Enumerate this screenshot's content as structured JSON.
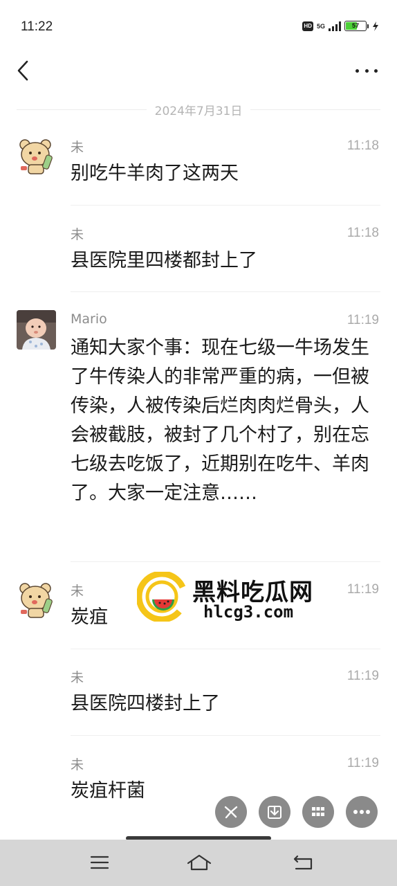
{
  "status_bar": {
    "time": "11:22",
    "hd_label": "HD",
    "network_label": "5G",
    "battery_level": "57",
    "battery_fraction": 0.57
  },
  "nav": {
    "back_icon": "chevron-left-icon",
    "more_icon": "ellipsis-icon"
  },
  "chat": {
    "date_divider": "2024年7月31日",
    "messages": [
      {
        "name": "未",
        "time": "11:18",
        "text": "别吃牛羊肉了这两天",
        "avatar": "bear-cartoon"
      },
      {
        "name": "未",
        "time": "11:18",
        "text": "县医院里四楼都封上了",
        "avatar": ""
      },
      {
        "name": "Mario",
        "time": "11:19",
        "text": "通知大家个事：现在七级一牛场发生了牛传染人的非常严重的病，一但被传染，人被传染后烂肉肉烂骨头，人会被截肢，被封了几个村了，别在忘七级去吃饭了，近期别在吃牛、羊肉了。大家一定注意……",
        "avatar": "baby-photo"
      },
      {
        "name": "未",
        "time": "11:19",
        "text": "炭疽",
        "avatar": "bear-cartoon"
      },
      {
        "name": "未",
        "time": "11:19",
        "text": "县医院四楼封上了",
        "avatar": ""
      },
      {
        "name": "未",
        "time": "11:19",
        "text": "炭疽杆菌",
        "avatar": ""
      }
    ]
  },
  "watermark": {
    "title": "黑料吃瓜网",
    "url": "hlcg3.com"
  },
  "floating_actions": [
    {
      "icon": "share-icon"
    },
    {
      "icon": "download-icon"
    },
    {
      "icon": "grid-icon"
    },
    {
      "icon": "more-icon"
    }
  ],
  "system_nav": {
    "menu_icon": "menu-icon",
    "home_icon": "home-icon",
    "back_icon": "return-icon"
  },
  "colors": {
    "battery_fill": "#4cd137",
    "watermark_yellow": "#f5c518",
    "watermark_green": "#2e9e44",
    "watermark_red": "#e53935",
    "fab_gray": "#8a8a8a"
  }
}
